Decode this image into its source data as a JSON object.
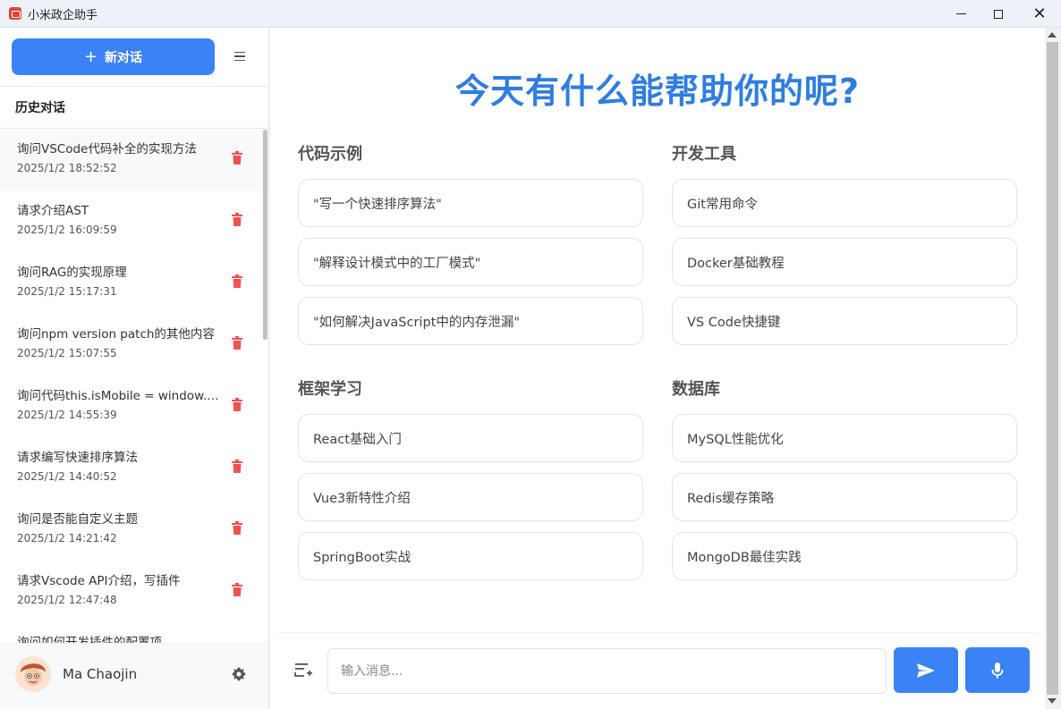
{
  "window": {
    "title": "小米政企助手",
    "icon": "app-logo-icon"
  },
  "sidebar": {
    "new_chat_label": "新对话",
    "history_title": "历史对话",
    "history": [
      {
        "title": "询问VSCode代码补全的实现方法",
        "time": "2025/1/2 18:52:52"
      },
      {
        "title": "请求介绍AST",
        "time": "2025/1/2 16:09:59"
      },
      {
        "title": "询问RAG的实现原理",
        "time": "2025/1/2 15:17:31"
      },
      {
        "title": "询问npm version patch的其他内容",
        "time": "2025/1/2 15:07:55"
      },
      {
        "title": "询问代码this.isMobile = window.innerWidth",
        "time": "2025/1/2 14:55:39"
      },
      {
        "title": "请求编写快速排序算法",
        "time": "2025/1/2 14:40:52"
      },
      {
        "title": "询问是否能自定义主题",
        "time": "2025/1/2 14:21:42"
      },
      {
        "title": "请求Vscode API介绍，写插件",
        "time": "2025/1/2 12:47:48"
      },
      {
        "title": "询问如何开发插件的配置项",
        "time": ""
      }
    ],
    "user_name": "Ma Chaojin"
  },
  "main": {
    "headline": "今天有什么能帮助你的呢?",
    "categories": [
      {
        "title": "代码示例",
        "items": [
          "\"写一个快速排序算法\"",
          "\"解释设计模式中的工厂模式\"",
          "\"如何解决JavaScript中的内存泄漏\""
        ]
      },
      {
        "title": "开发工具",
        "items": [
          "Git常用命令",
          "Docker基础教程",
          "VS Code快捷键"
        ]
      },
      {
        "title": "框架学习",
        "items": [
          "React基础入门",
          "Vue3新特性介绍",
          "SpringBoot实战"
        ]
      },
      {
        "title": "数据库",
        "items": [
          "MySQL性能优化",
          "Redis缓存策略",
          "MongoDB最佳实践"
        ]
      }
    ],
    "input_placeholder": "输入消息..."
  },
  "colors": {
    "accent": "#3b82f6",
    "headline": "#2f7de1",
    "delete": "#f05252"
  }
}
